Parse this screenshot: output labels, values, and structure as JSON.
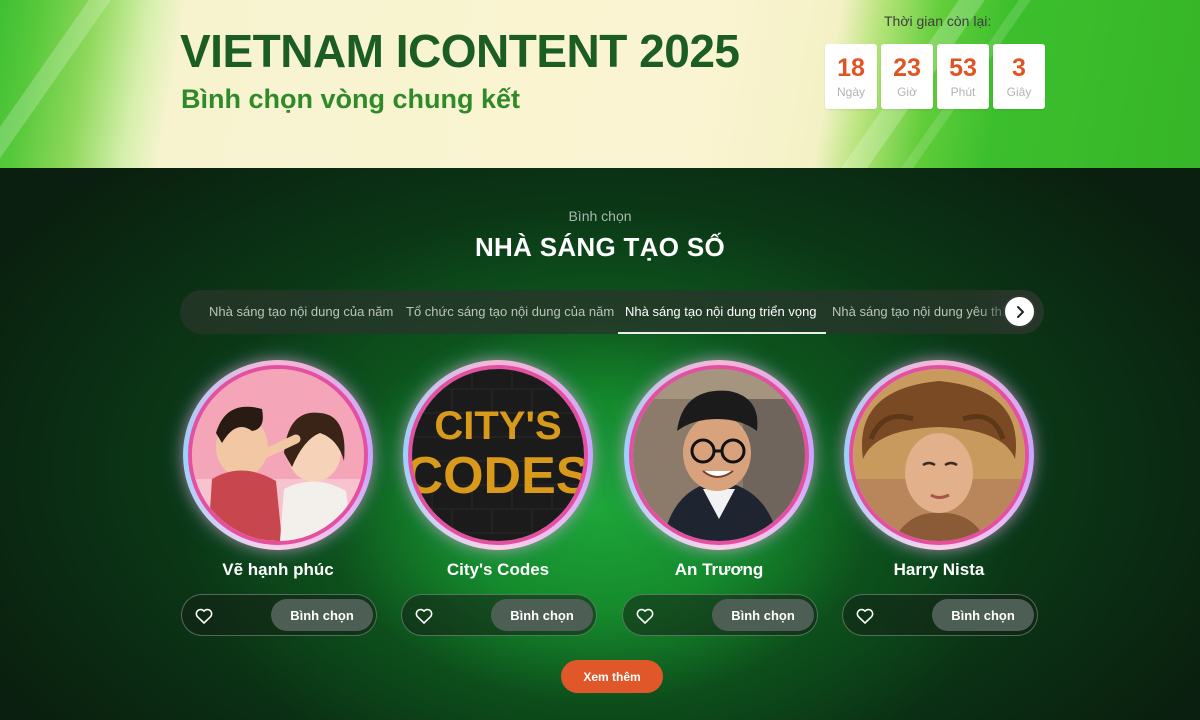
{
  "header": {
    "title": "VIETNAM ICONTENT 2025",
    "subtitle": "Bình chọn vòng chung kết",
    "countdown_label": "Thời gian còn lại:",
    "countdown": [
      {
        "value": "18",
        "unit": "Ngày"
      },
      {
        "value": "23",
        "unit": "Giờ"
      },
      {
        "value": "53",
        "unit": "Phút"
      },
      {
        "value": "3",
        "unit": "Giây"
      }
    ]
  },
  "section": {
    "kicker": "Bình chọn",
    "title": "NHÀ SÁNG TẠO SỐ"
  },
  "tabs": [
    {
      "label": "Nhà sáng tạo nội dung của năm",
      "active": false
    },
    {
      "label": "Tổ chức sáng tạo nội dung của năm",
      "active": false
    },
    {
      "label": "Nhà sáng tạo nội dung triển vọng",
      "active": true
    },
    {
      "label": "Nhà sáng tạo nội dung yêu thích",
      "active": false
    }
  ],
  "candidates": [
    {
      "name": "Vẽ hạnh phúc",
      "vote_label": "Bình chọn"
    },
    {
      "name": "City's Codes",
      "vote_label": "Bình chọn"
    },
    {
      "name": "An Trương",
      "vote_label": "Bình chọn"
    },
    {
      "name": "Harry Nista",
      "vote_label": "Bình chọn"
    }
  ],
  "logo_text": {
    "line1": "CITY'S",
    "line2": "CODES"
  },
  "more_label": "Xem thêm",
  "colors": {
    "title_green": "#1c5d24",
    "subtitle_green": "#2f8a2a",
    "countdown_orange": "#e05424",
    "more_button": "#e0572a",
    "vote_button": "#4d5f54"
  },
  "icons": {
    "tab_next": "chevron-right-icon",
    "vote": "heart-icon"
  }
}
